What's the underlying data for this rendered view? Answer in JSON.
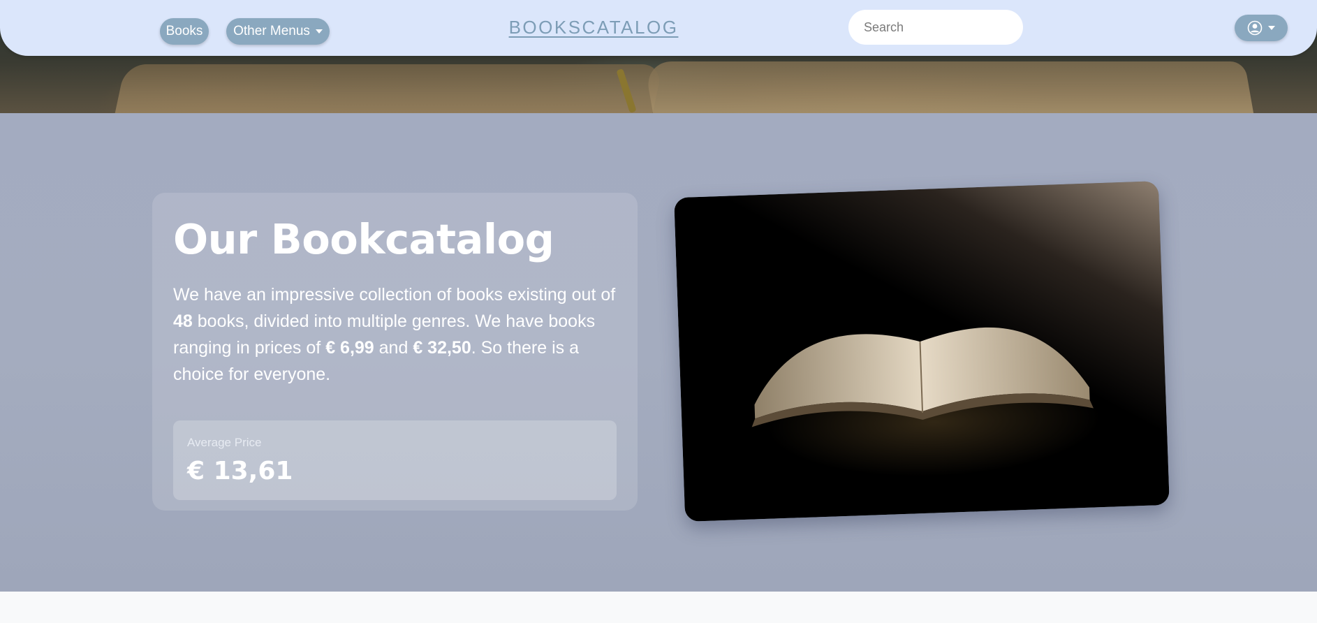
{
  "navbar": {
    "books_label": "Books",
    "other_menus_label": "Other Menus",
    "brand": "BOOKSCATALOG",
    "search_placeholder": "Search"
  },
  "hero": {
    "title": "Our Bookcatalog",
    "description": {
      "part1": "We have an impressive collection of books existing out of ",
      "book_count": "48",
      "part2": " books, divided into multiple genres. We have books ranging in prices of ",
      "min_price": "€ 6,99",
      "part3": " and ",
      "max_price": "€ 32,50",
      "part4": ". So there is a choice for everyone."
    },
    "stat": {
      "label": "Average Price",
      "value": "€ 13,61"
    }
  },
  "icons": {
    "search": "search-icon",
    "user": "user-circle-icon",
    "caret": "caret-down-icon"
  },
  "colors": {
    "navbar_bg": "#dbe6fb",
    "pill_bg": "#8aa8bf",
    "brand": "#7d9db6",
    "hero_bg": "#a3abc0"
  }
}
